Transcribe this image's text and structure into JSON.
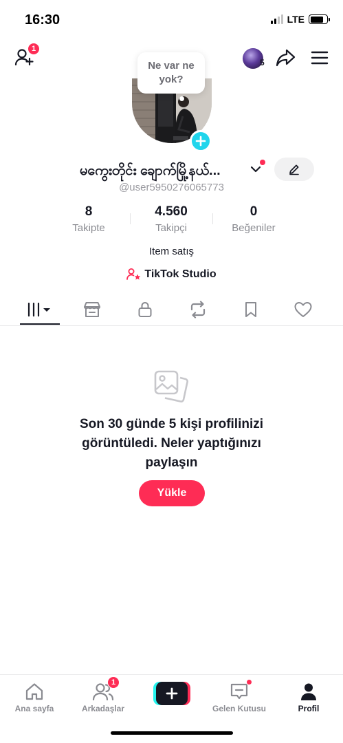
{
  "status_bar": {
    "time": "16:30",
    "network": "LTE",
    "battery_level": 0.8
  },
  "top_bar": {
    "add_friend_badge": "1",
    "story_count": "5"
  },
  "profile": {
    "bubble_text": "Ne var ne yok?",
    "display_name": "မကွေးတိုင်း ချောက်မြို့နယ်...",
    "username": "@user5950276065773",
    "bio": "Item satış",
    "studio_link": "TikTok Studio"
  },
  "stats": [
    {
      "value": "8",
      "label": "Takipte"
    },
    {
      "value": "4.560",
      "label": "Takipçi"
    },
    {
      "value": "0",
      "label": "Beğeniler"
    }
  ],
  "tabs": [
    {
      "name": "videos",
      "icon": "grid-icon",
      "active": true
    },
    {
      "name": "shop",
      "icon": "shop-icon",
      "active": false
    },
    {
      "name": "private",
      "icon": "lock-icon",
      "active": false
    },
    {
      "name": "reposts",
      "icon": "repost-icon",
      "active": false
    },
    {
      "name": "favorites",
      "icon": "bookmark-icon",
      "active": false
    },
    {
      "name": "liked",
      "icon": "heart-icon",
      "active": false
    }
  ],
  "empty_state": {
    "message": "Son 30 günde 5 kişi profilinizi görüntüledi. Neler yaptığınızı paylaşın",
    "button_label": "Yükle"
  },
  "bottom_nav": {
    "home": "Ana sayfa",
    "friends": "Arkadaşlar",
    "friends_badge": "1",
    "inbox": "Gelen Kutusu",
    "profile": "Profil"
  },
  "colors": {
    "accent": "#fe2c55",
    "cyan": "#25f4ee",
    "avatar_add": "#20d5ec",
    "text": "#161823",
    "muted": "#8a8b91"
  }
}
